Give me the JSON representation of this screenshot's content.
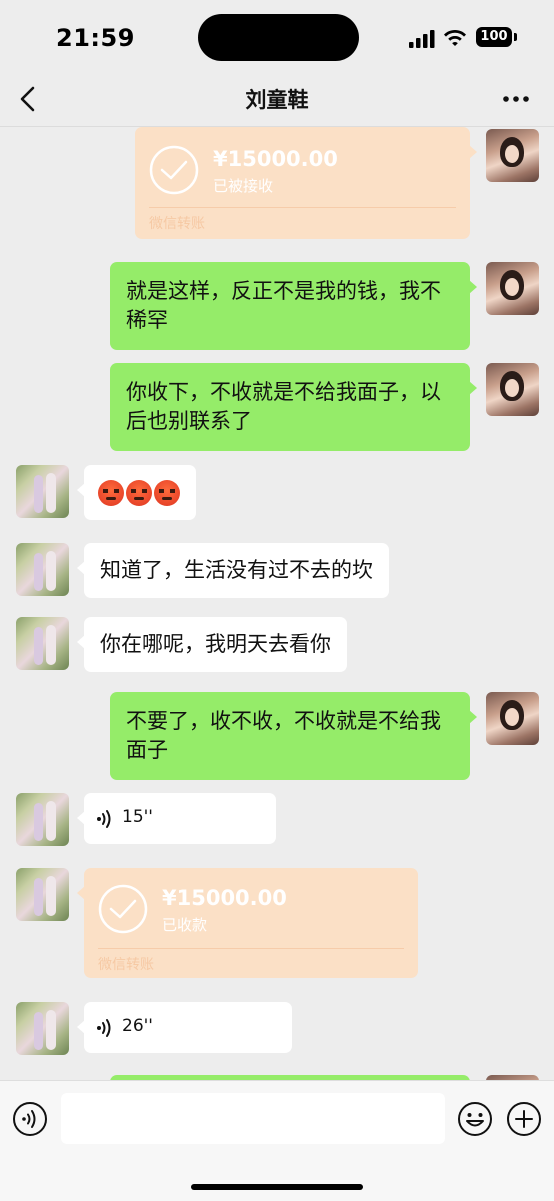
{
  "status": {
    "time": "21:59",
    "battery": "100"
  },
  "nav": {
    "title": "刘童鞋"
  },
  "messages": {
    "m1": {
      "amount": "¥15000.00",
      "status": "已被接收",
      "label": "微信转账"
    },
    "m2": {
      "text": "就是这样，反正不是我的钱，我不稀罕"
    },
    "m3": {
      "text": "你收下，不收就是不给我面子，以后也别联系了"
    },
    "m4": {
      "emoji": "angry-face x3"
    },
    "m5": {
      "text": "知道了，生活没有过不去的坎"
    },
    "m6": {
      "text": "你在哪呢，我明天去看你"
    },
    "m7": {
      "text": "不要了，收不收，不收就是不给我面子"
    },
    "m8": {
      "duration": "15''"
    },
    "m9": {
      "amount": "¥15000.00",
      "status": "已收款",
      "label": "微信转账"
    },
    "m10": {
      "duration": "26''"
    }
  },
  "icons": {
    "back": "chevron-left-icon",
    "more": "more-dots-icon",
    "voice_toggle": "voice-icon",
    "emoji": "emoji-icon",
    "plus": "plus-icon"
  },
  "colors": {
    "background": "#ededed",
    "sent_bubble": "#95ec69",
    "received_bubble": "#ffffff",
    "transfer_card": "#fbe0c6"
  },
  "input": {
    "value": "",
    "placeholder": ""
  }
}
